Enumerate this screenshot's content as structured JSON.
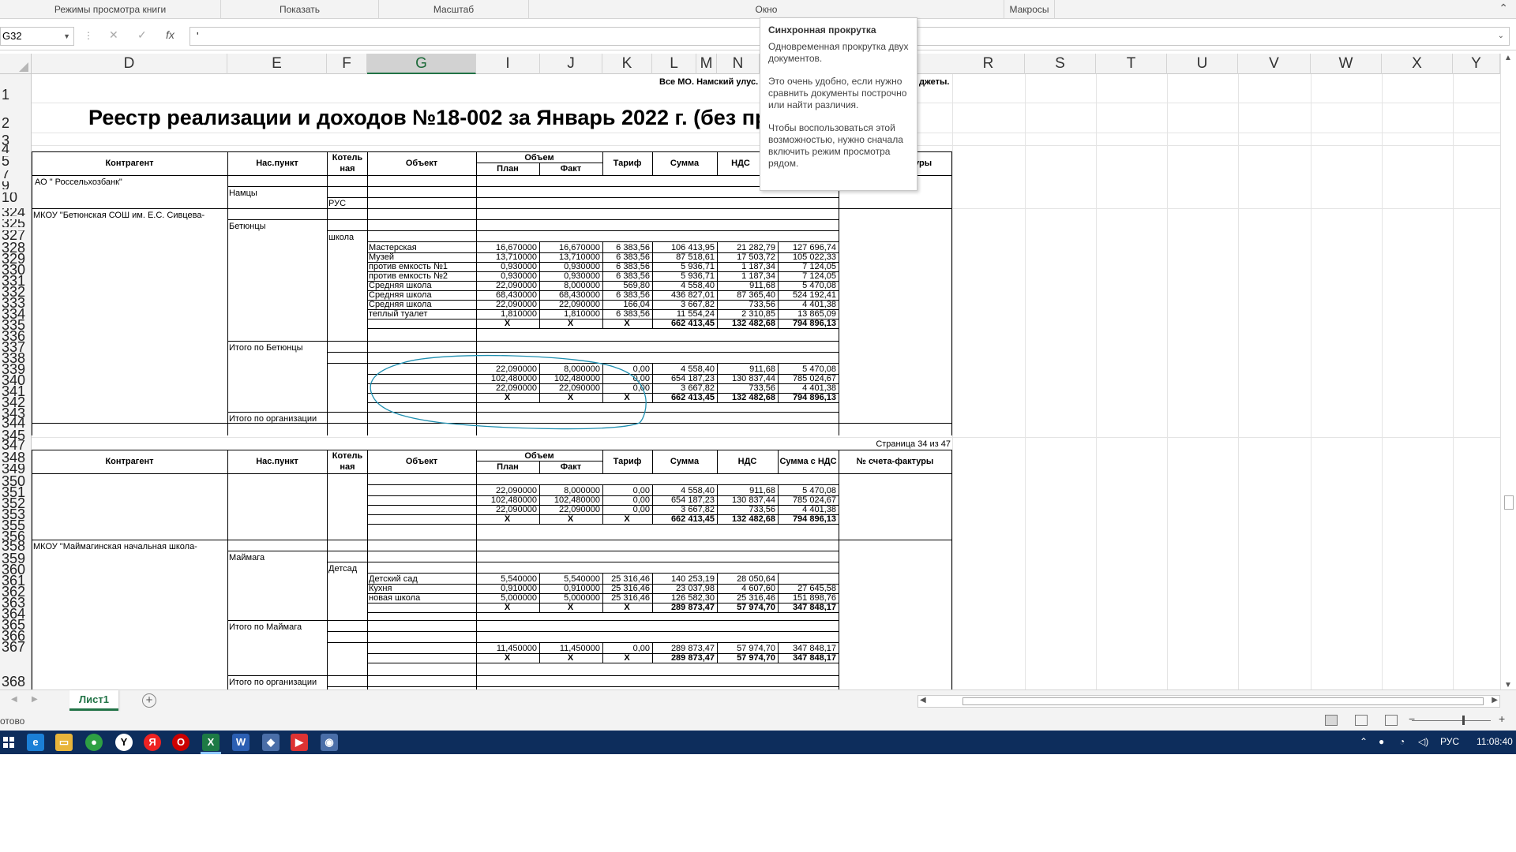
{
  "ribbon": {
    "groups": [
      "Режимы просмотра книги",
      "Показать",
      "Масштаб",
      "Окно",
      "Макросы"
    ]
  },
  "formula_bar": {
    "name_box": "G32",
    "formula": "'",
    "icons": [
      "cancel-icon",
      "enter-icon",
      "fx-icon"
    ]
  },
  "columns": [
    "D",
    "E",
    "F",
    "G",
    "I",
    "J",
    "K",
    "L",
    "M",
    "N",
    "R",
    "S",
    "T",
    "U",
    "V",
    "W",
    "X",
    "Y"
  ],
  "rows": [
    "1",
    "2",
    "3",
    "4",
    "5",
    "7",
    "9",
    "10",
    "324",
    "325",
    "327",
    "328",
    "329",
    "330",
    "331",
    "332",
    "333",
    "334",
    "335",
    "336",
    "337",
    "338",
    "339",
    "340",
    "341",
    "342",
    "343",
    "344",
    "345",
    "347",
    "348",
    "349",
    "350",
    "351",
    "352",
    "353",
    "355",
    "356",
    "358",
    "359",
    "360",
    "361",
    "362",
    "363",
    "364",
    "365",
    "366",
    "367",
    "368"
  ],
  "sheet": {
    "title": "Реестр реализации и доходов  №18-002 за Январь 2022 г. (без при",
    "top_right": "Все МО. Намский улус.",
    "top_right_tail": "джеты.",
    "page_label": "Страница 34 из 47",
    "headers": {
      "kontragent": "Контрагент",
      "naspunkt": "Нас.пункт",
      "kotelnaya": "Котель ная",
      "obekt": "Объект",
      "obem": "Объем",
      "plan": "План",
      "fakt": "Факт",
      "tarif": "Тариф",
      "summa": "Сумма",
      "nds": "НДС",
      "summa_nds": "Сумма с НДС",
      "schet": "№ счета-фактуры",
      "schet_tail": "уры"
    },
    "section1": {
      "org1": "АО \" Россельхозбанк\"",
      "settlement1": "Намцы",
      "boiler1": "РУС",
      "org2": "МКОУ  \"Бетюнская СОШ им. Е.С. Сивцева-",
      "settlement2": "Бетюнцы",
      "boiler2": "школа",
      "rows": [
        [
          "Мастерская",
          "16,670000",
          "16,670000",
          "6 383,56",
          "106 413,95",
          "21 282,79",
          "127 696,74"
        ],
        [
          "Музей",
          "13,710000",
          "13,710000",
          "6 383,56",
          "87 518,61",
          "17 503,72",
          "105 022,33"
        ],
        [
          "против емкость №1",
          "0,930000",
          "0,930000",
          "6 383,56",
          "5 936,71",
          "1 187,34",
          "7 124,05"
        ],
        [
          "против емкость №2",
          "0,930000",
          "0,930000",
          "6 383,56",
          "5 936,71",
          "1 187,34",
          "7 124,05"
        ],
        [
          "Средняя школа",
          "22,090000",
          "8,000000",
          "569,80",
          "4 558,40",
          "911,68",
          "5 470,08"
        ],
        [
          "Средняя школа",
          "68,430000",
          "68,430000",
          "6 383,56",
          "436 827,01",
          "87 365,40",
          "524 192,41"
        ],
        [
          "Средняя школа",
          "22,090000",
          "22,090000",
          "166,04",
          "3 667,82",
          "733,56",
          "4 401,38"
        ],
        [
          "теплый туалет",
          "1,810000",
          "1,810000",
          "6 383,56",
          "11 554,24",
          "2 310,85",
          "13 865,09"
        ]
      ],
      "total_row": [
        "X",
        "X",
        "X",
        "662 413,45",
        "132 482,68",
        "794 896,13"
      ],
      "itogo_settlement": "Итого по Бетюнцы",
      "itogo_rows": [
        [
          "22,090000",
          "8,000000",
          "0,00",
          "4 558,40",
          "911,68",
          "5 470,08"
        ],
        [
          "102,480000",
          "102,480000",
          "0,00",
          "654 187,23",
          "130 837,44",
          "785 024,67"
        ],
        [
          "22,090000",
          "22,090000",
          "0,00",
          "3 667,82",
          "733,56",
          "4 401,38"
        ]
      ],
      "itogo_total": [
        "X",
        "X",
        "X",
        "662 413,45",
        "132 482,68",
        "794 896,13"
      ],
      "itogo_org": "Итого по организации"
    },
    "section2": {
      "carry_rows": [
        [
          "22,090000",
          "8,000000",
          "0,00",
          "4 558,40",
          "911,68",
          "5 470,08"
        ],
        [
          "102,480000",
          "102,480000",
          "0,00",
          "654 187,23",
          "130 837,44",
          "785 024,67"
        ],
        [
          "22,090000",
          "22,090000",
          "0,00",
          "3 667,82",
          "733,56",
          "4 401,38"
        ]
      ],
      "carry_total": [
        "X",
        "X",
        "X",
        "662 413,45",
        "132 482,68",
        "794 896,13"
      ],
      "org": "МКОУ  \"Маймагинская  начальная школа-",
      "settlement": "Маймага",
      "boiler": "Детсад",
      "rows": [
        [
          "Детский сад",
          "5,540000",
          "5,540000",
          "25 316,46",
          "140 253,19",
          "28 050,64",
          ""
        ],
        [
          "Кухня",
          "0,910000",
          "0,910000",
          "25 316,46",
          "23 037,98",
          "4 607,60",
          "27 645,58"
        ],
        [
          "новая школа",
          "5,000000",
          "5,000000",
          "25 316,46",
          "126 582,30",
          "25 316,46",
          "151 898,76"
        ]
      ],
      "total_row": [
        "X",
        "X",
        "X",
        "289 873,47",
        "57 974,70",
        "347 848,17"
      ],
      "itogo_settlement": "Итого по Маймага",
      "itogo_rows": [
        [
          "11,450000",
          "11,450000",
          "0,00",
          "289 873,47",
          "57 974,70",
          "347 848,17"
        ]
      ],
      "itogo_total": [
        "X",
        "X",
        "X",
        "289 873,47",
        "57 974,70",
        "347 848,17"
      ],
      "itogo_org": "Итого по организации"
    }
  },
  "tooltip": {
    "title": "Синхронная прокрутка",
    "p1": "Одновременная прокрутка двух документов.",
    "p2": "Это очень удобно, если нужно сравнить документы построчно или найти различия.",
    "p3": "Чтобы воспользоваться этой возможностью, нужно сначала включить режим просмотра рядом."
  },
  "tabs": {
    "sheet_name": "Лист1",
    "add": "+"
  },
  "status": {
    "ready": "отово"
  },
  "taskbar": {
    "lang": "РУС",
    "time": "11:08:40",
    "apps": [
      "edge-icon",
      "explorer-icon",
      "chrome-icon",
      "yandex-icon",
      "yandex-browser-icon",
      "opera-icon",
      "excel-icon",
      "word-icon",
      "app-icon",
      "media-icon",
      "network-app-icon"
    ]
  },
  "colors": {
    "excel_green": "#217346",
    "taskbar": "#0d2d5c",
    "annotation_ink": "#1f8fb0"
  }
}
